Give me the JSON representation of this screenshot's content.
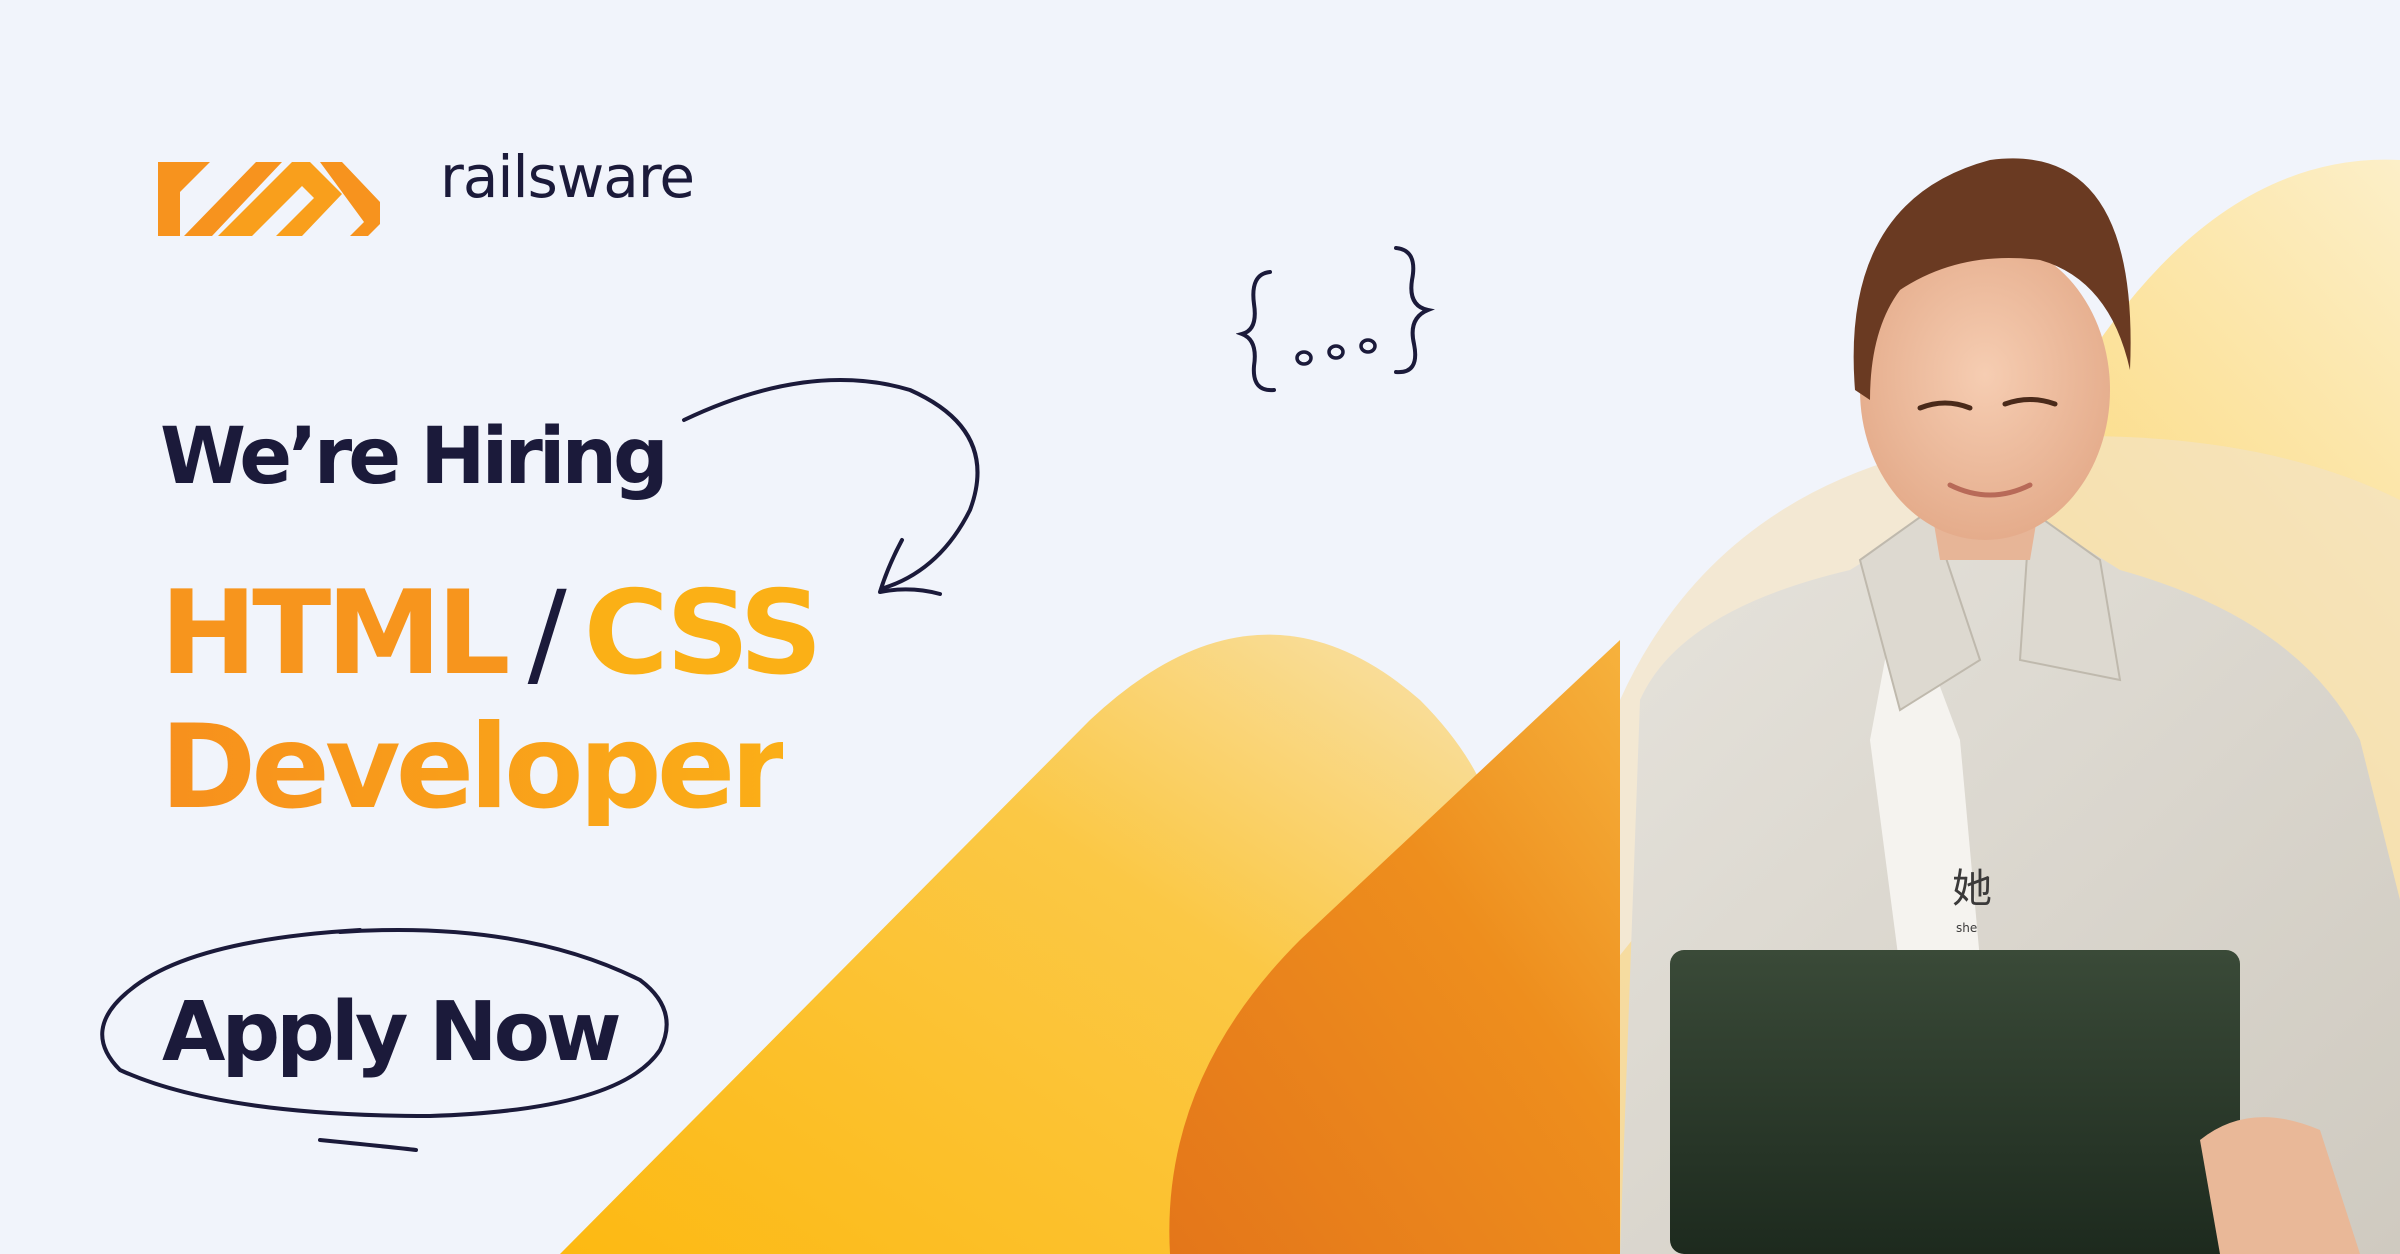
{
  "brand": {
    "name": "railsware",
    "logo_icon": "railsware-stripes-logo",
    "orange": "#f7931e",
    "yellow": "#fbb016",
    "navy": "#1b1a3a"
  },
  "headline": {
    "intro": "We’re Hiring",
    "role_part1": "HTML",
    "separator": "/",
    "role_part2": "CSS",
    "role_part3": "Developer"
  },
  "cta": {
    "label": "Apply Now"
  },
  "decorations": {
    "braces_icon": "curly-braces-ellipsis-doodle",
    "arrow_icon": "curved-arrow-doodle"
  },
  "photo": {
    "shirt_text": "她",
    "shirt_subtext": "she"
  }
}
